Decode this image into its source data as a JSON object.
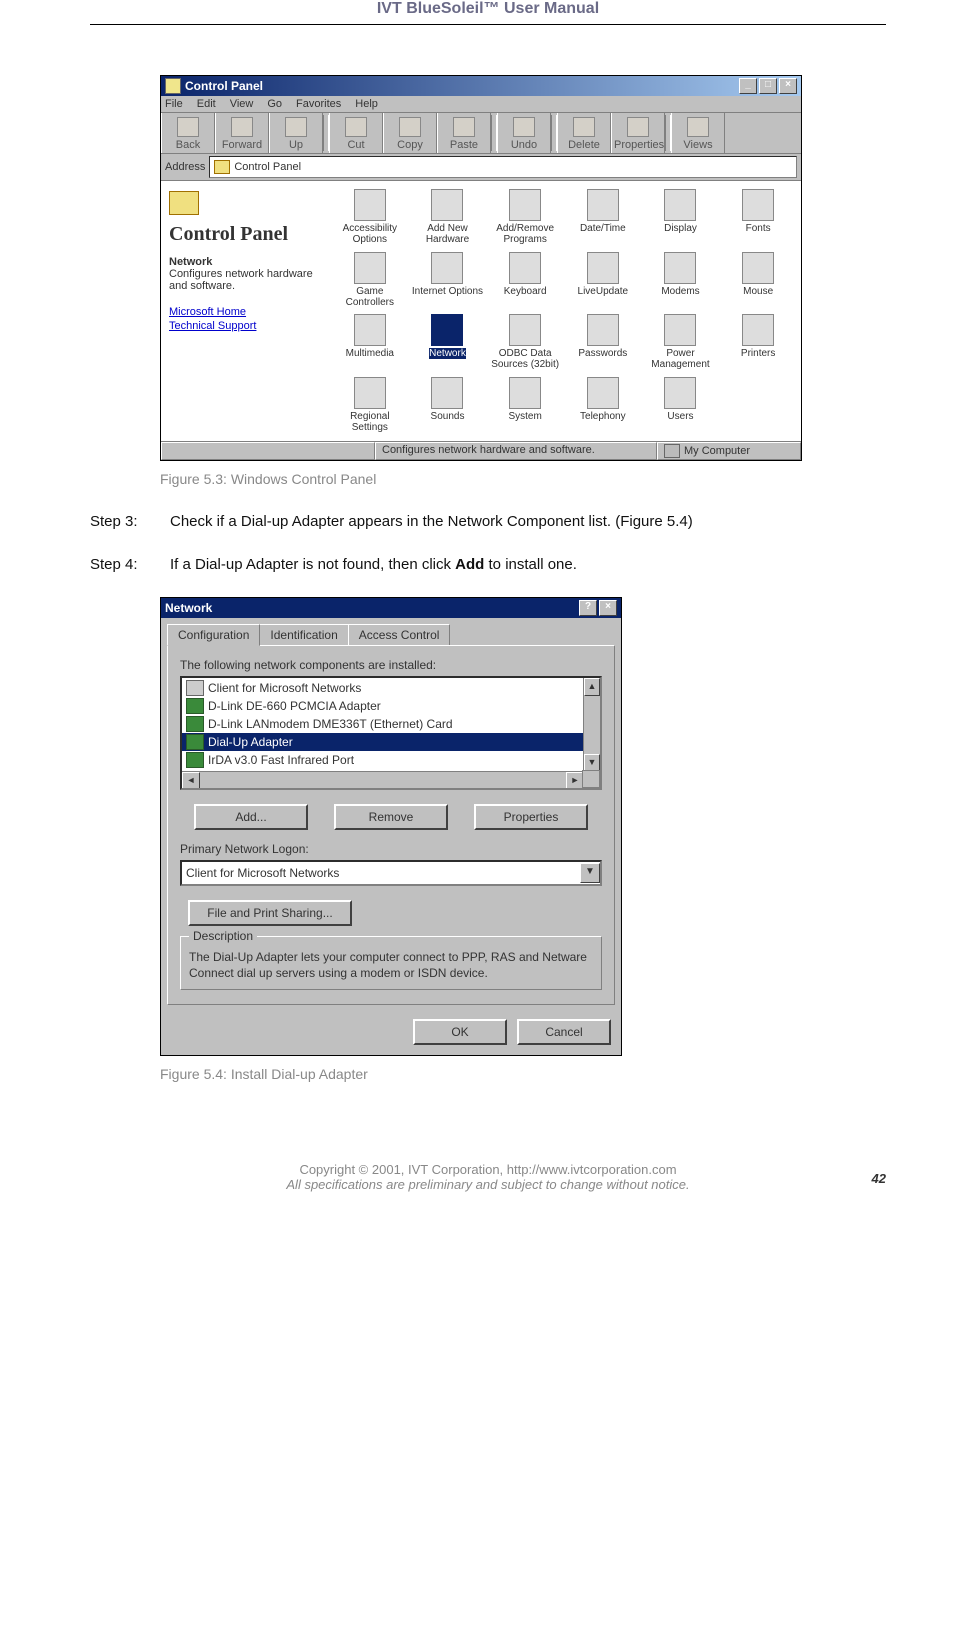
{
  "header": {
    "title": "IVT BlueSoleil™ User Manual"
  },
  "fig1": {
    "caption": "Figure 5.3: Windows Control Panel",
    "window_title": "Control Panel",
    "menus": [
      "File",
      "Edit",
      "View",
      "Go",
      "Favorites",
      "Help"
    ],
    "toolbar": [
      "Back",
      "Forward",
      "Up",
      "Cut",
      "Copy",
      "Paste",
      "Undo",
      "Delete",
      "Properties",
      "Views"
    ],
    "address_label": "Address",
    "address_value": "Control Panel",
    "side": {
      "heading": "Control Panel",
      "bold": "Network",
      "desc": "Configures network hardware and software.",
      "links": [
        "Microsoft Home",
        "Technical Support"
      ]
    },
    "icons": [
      "Accessibility Options",
      "Add New Hardware",
      "Add/Remove Programs",
      "Date/Time",
      "Display",
      "Fonts",
      "Game Controllers",
      "Internet Options",
      "Keyboard",
      "LiveUpdate",
      "Modems",
      "Mouse",
      "Multimedia",
      "Network",
      "ODBC Data Sources (32bit)",
      "Passwords",
      "Power Management",
      "Printers",
      "Regional Settings",
      "Sounds",
      "System",
      "Telephony",
      "Users"
    ],
    "selected_icon_index": 13,
    "status_left": "Configures network hardware and software.",
    "status_right": "My Computer"
  },
  "steps": {
    "s3_label": "Step 3:",
    "s3_text": "Check if a Dial-up Adapter appears in the Network Component list. (Figure 5.4)",
    "s4_label": "Step 4:",
    "s4_text_pre": "If a Dial-up Adapter is not found, then click ",
    "s4_bold": "Add",
    "s4_text_post": " to install one."
  },
  "fig2": {
    "caption": "Figure 5.4: Install Dial-up Adapter",
    "dialog_title": "Network",
    "tabs": [
      "Configuration",
      "Identification",
      "Access Control"
    ],
    "list_label": "The following network components are installed:",
    "items": [
      {
        "label": "Client for Microsoft Networks",
        "kind": "client"
      },
      {
        "label": "D-Link DE-660 PCMCIA Adapter",
        "kind": "adapter"
      },
      {
        "label": "D-Link LANmodem DME336T (Ethernet) Card",
        "kind": "adapter"
      },
      {
        "label": "Dial-Up Adapter",
        "kind": "adapter"
      },
      {
        "label": "IrDA v3.0 Fast Infrared Port",
        "kind": "adapter"
      }
    ],
    "selected_item_index": 3,
    "buttons": {
      "add": "Add...",
      "remove": "Remove",
      "properties": "Properties"
    },
    "logon_label": "Primary Network Logon:",
    "logon_value": "Client for Microsoft Networks",
    "file_print": "File and Print Sharing...",
    "desc_legend": "Description",
    "desc_text": "The Dial-Up Adapter lets your computer connect to PPP, RAS and Netware Connect dial up servers using a modem or ISDN device.",
    "ok": "OK",
    "cancel": "Cancel"
  },
  "footer": {
    "line1": "Copyright © 2001, IVT Corporation, http://www.ivtcorporation.com",
    "line2": "All specifications are preliminary and subject to change without notice.",
    "page": "42"
  }
}
